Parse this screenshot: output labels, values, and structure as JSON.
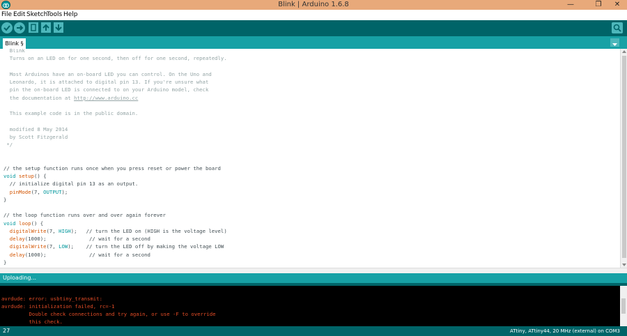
{
  "window": {
    "title": "Blink | Arduino 1.6.8",
    "min_glyph": "—",
    "max_glyph": "❐",
    "close_glyph": "✕"
  },
  "menu": [
    "File",
    "Edit",
    "Sketch",
    "Tools",
    "Help"
  ],
  "toolbar": {
    "buttons": [
      "verify-icon",
      "upload-icon",
      "new-icon",
      "open-icon",
      "save-icon"
    ],
    "serial_monitor": "magnifier-icon"
  },
  "tab": {
    "label": "Blink §"
  },
  "editor": {
    "lines": [
      [
        {
          "t": "  Blink",
          "c": "comment"
        }
      ],
      [
        {
          "t": "  Turns on an LED on for one second, then off for one second, repeatedly.",
          "c": "comment"
        }
      ],
      [
        {
          "t": "",
          "c": "plain"
        }
      ],
      [
        {
          "t": "  Most Arduinos have an on-board LED you can control. On the Uno and",
          "c": "comment"
        }
      ],
      [
        {
          "t": "  Leonardo, it is attached to digital pin 13. If you're unsure what",
          "c": "comment"
        }
      ],
      [
        {
          "t": "  pin the on-board LED is connected to on your Arduino model, check",
          "c": "comment"
        }
      ],
      [
        {
          "t": "  the documentation at ",
          "c": "comment"
        },
        {
          "t": "http://www.arduino.cc",
          "c": "link"
        }
      ],
      [
        {
          "t": "",
          "c": "plain"
        }
      ],
      [
        {
          "t": "  This example code is in the public domain.",
          "c": "comment"
        }
      ],
      [
        {
          "t": "",
          "c": "plain"
        }
      ],
      [
        {
          "t": "  modified 8 May 2014",
          "c": "comment"
        }
      ],
      [
        {
          "t": "  by Scott Fitzgerald",
          "c": "comment"
        }
      ],
      [
        {
          "t": " */",
          "c": "comment"
        }
      ],
      [
        {
          "t": "",
          "c": "plain"
        }
      ],
      [
        {
          "t": "",
          "c": "plain"
        }
      ],
      [
        {
          "t": "// the setup function runs once when you press reset or power the board",
          "c": "plain"
        }
      ],
      [
        {
          "t": "void",
          "c": "keyword"
        },
        {
          "t": " ",
          "c": "plain"
        },
        {
          "t": "setup",
          "c": "fn"
        },
        {
          "t": "() {",
          "c": "plain"
        }
      ],
      [
        {
          "t": "  // initialize digital pin 13 as an output.",
          "c": "plain"
        }
      ],
      [
        {
          "t": "  ",
          "c": "plain"
        },
        {
          "t": "pinMode",
          "c": "fn"
        },
        {
          "t": "(7, ",
          "c": "plain"
        },
        {
          "t": "OUTPUT",
          "c": "const"
        },
        {
          "t": ");",
          "c": "plain"
        }
      ],
      [
        {
          "t": "}",
          "c": "plain"
        }
      ],
      [
        {
          "t": "",
          "c": "plain"
        }
      ],
      [
        {
          "t": "// the loop function runs over and over again forever",
          "c": "plain"
        }
      ],
      [
        {
          "t": "void",
          "c": "keyword"
        },
        {
          "t": " ",
          "c": "plain"
        },
        {
          "t": "loop",
          "c": "fn"
        },
        {
          "t": "() {",
          "c": "plain"
        }
      ],
      [
        {
          "t": "  ",
          "c": "plain"
        },
        {
          "t": "digitalWrite",
          "c": "fn"
        },
        {
          "t": "(7, ",
          "c": "plain"
        },
        {
          "t": "HIGH",
          "c": "const"
        },
        {
          "t": ");   // turn the LED on (HIGH is the voltage level)",
          "c": "plain"
        }
      ],
      [
        {
          "t": "  ",
          "c": "plain"
        },
        {
          "t": "delay",
          "c": "fn"
        },
        {
          "t": "(1000);              // wait for a second",
          "c": "plain"
        }
      ],
      [
        {
          "t": "  ",
          "c": "plain"
        },
        {
          "t": "digitalWrite",
          "c": "fn"
        },
        {
          "t": "(7, ",
          "c": "plain"
        },
        {
          "t": "LOW",
          "c": "const"
        },
        {
          "t": ");    // turn the LED off by making the voltage LOW",
          "c": "plain"
        }
      ],
      [
        {
          "t": "  ",
          "c": "plain"
        },
        {
          "t": "delay",
          "c": "fn"
        },
        {
          "t": "(1000);              // wait for a second",
          "c": "plain"
        }
      ],
      [
        {
          "t": "}",
          "c": "plain"
        }
      ]
    ]
  },
  "status": {
    "text": "Uploading..."
  },
  "console": {
    "lines": [
      "",
      "avrdude: error: usbtiny_transmit:",
      "avrdude: initialization failed, rc=-1",
      "         Double check connections and try again, or use -F to override",
      "         this check."
    ]
  },
  "footer": {
    "line_number": "27",
    "board": "ATtiny, ATtiny44, 20 MHz (external) on COM3"
  },
  "colors": {
    "teal_dark": "#006468",
    "teal_mid": "#17a1a5",
    "teal_light": "#4db7bb",
    "keyword": "#00979c",
    "function": "#d35400",
    "comment": "#95a5a6",
    "error": "#e34c26"
  }
}
